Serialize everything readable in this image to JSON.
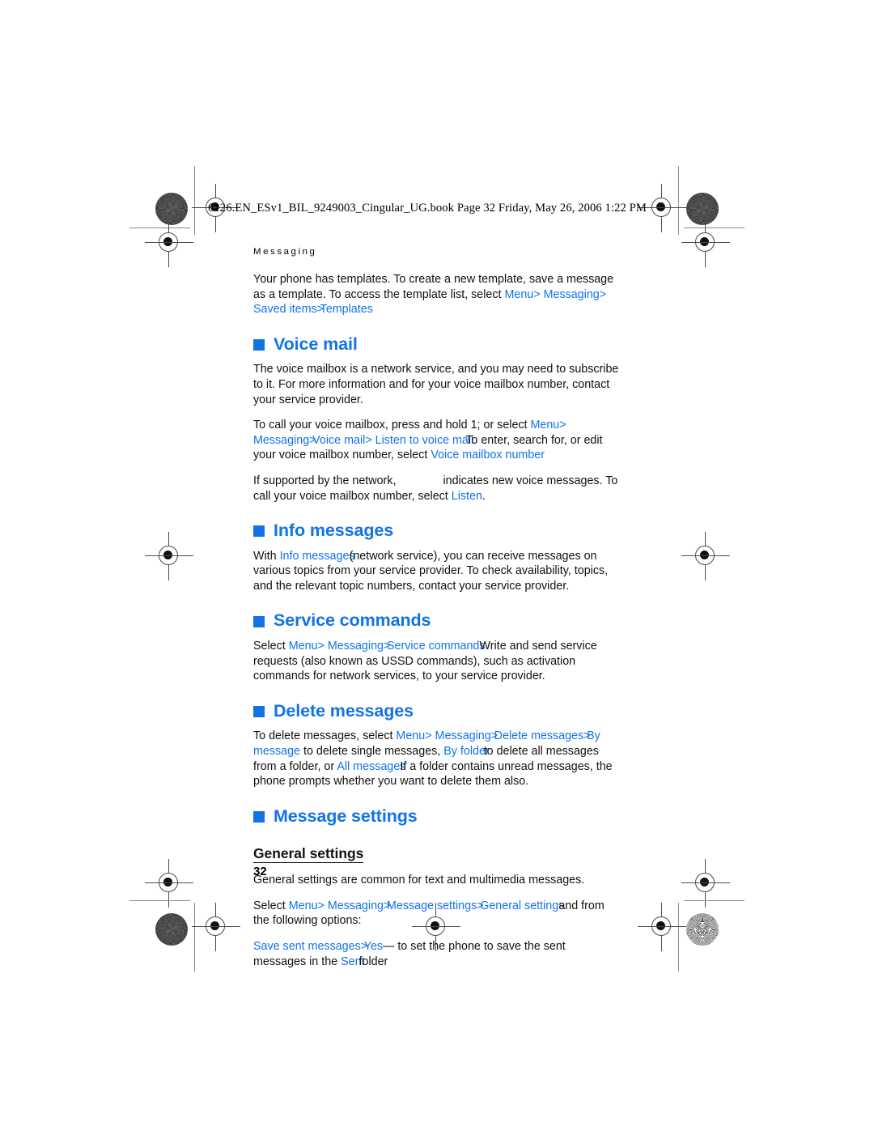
{
  "header": {
    "filestamp": "6126.EN_ESv1_BIL_9249003_Cingular_UG.book  Page 32  Friday, May 26, 2006  1:22 PM"
  },
  "running_head": "Messaging",
  "page_number": "32",
  "colors": {
    "link_blue": "#1273e6",
    "text_black": "#111111"
  },
  "intro": {
    "line1": "Your phone has templates. To create a new template, save a message as a template.",
    "line2_prefix": "To access the template list, select ",
    "menu": "Menu",
    "sep": ">",
    "messaging": "Messaging",
    "saved_items": "Saved items",
    "templates": "Templates"
  },
  "voice_mail": {
    "heading": "Voice mail",
    "p1": "The voice mailbox is a network service, and you may need to subscribe to it. For more information and for your voice mailbox number, contact your service provider.",
    "p2_prefix": "To call your voice mailbox, press and hold 1; or select ",
    "menu": "Menu",
    "messaging": "Messaging",
    "voice_mail_item": "Voice mail",
    "listen_to_voice_mail": "Listen to voice mail",
    "p2_mid": "To enter, search for, or edit your voice mailbox number, select ",
    "voice_mailbox_number": "Voice mailbox number",
    "p3_prefix": "If supported by the network,",
    "p3_mid": "indicates new voice messages. To call your voice mailbox number, select ",
    "listen": "Listen",
    "p3_end": "."
  },
  "info_messages": {
    "heading": "Info messages",
    "p1_prefix": "With ",
    "term": "Info messages",
    "p1_rest": "(network service), you can receive messages on various topics from your service provider. To check availability, topics, and the relevant topic numbers, contact your service provider."
  },
  "service_commands": {
    "heading": "Service commands",
    "p1_prefix": "Select ",
    "menu": "Menu",
    "messaging": "Messaging",
    "service_commands_item": "Service commands",
    "p1_rest": "Write and send service requests (also known as USSD commands), such as activation commands for network services, to your service provider."
  },
  "delete_messages": {
    "heading": "Delete messages",
    "p1_prefix": "To delete messages, select ",
    "menu": "Menu",
    "messaging": "Messaging",
    "delete_messages_item": "Delete messages",
    "by_message": "By message",
    "mid1": "to delete single messages, ",
    "by_folder": "By folder",
    "mid2": "to delete all messages from a folder, or ",
    "all_messages": "All messages",
    "p1_rest": "If a folder contains unread messages, the phone prompts whether you want to delete them also."
  },
  "message_settings": {
    "heading": "Message settings",
    "subheading": "General settings",
    "p1": "General settings are common for text and multimedia messages.",
    "p2_prefix": "Select ",
    "menu": "Menu",
    "messaging": "Messaging",
    "message_settings_item": "Message settings",
    "general_settings_item": "General settings",
    "p2_rest": "and from the following options:",
    "p3_term": "Save sent messages",
    "p3_value": "Yes",
    "p3_mid": "— to set the phone to save the sent messages in the ",
    "p3_folder": "Sent",
    "p3_end": "folder"
  }
}
